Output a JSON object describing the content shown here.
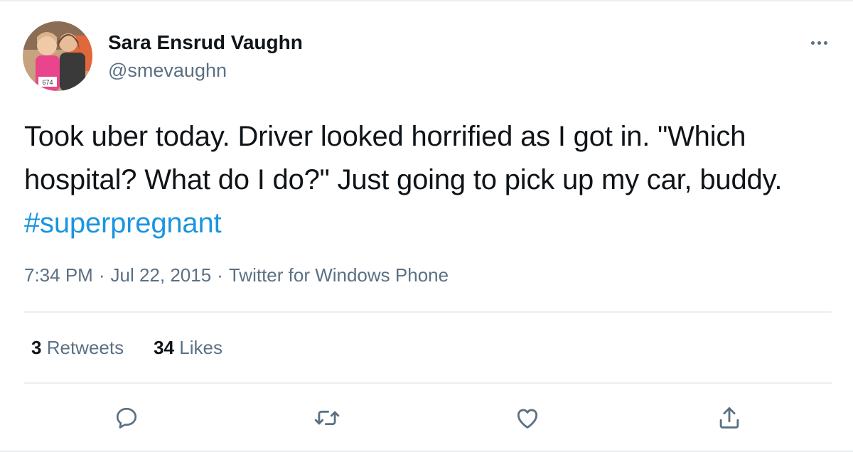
{
  "user": {
    "display_name": "Sara Ensrud Vaughn",
    "handle": "@smevaughn"
  },
  "tweet": {
    "text": "Took uber today. Driver looked horrified as I got in. \"Which hospital? What do I do?\" Just going to pick up my car, buddy. ",
    "hashtag": "#superpregnant"
  },
  "meta": {
    "time": "7:34 PM",
    "separator": "·",
    "date": "Jul 22, 2015",
    "source": "Twitter for Windows Phone"
  },
  "stats": {
    "retweets_count": "3",
    "retweets_label": "Retweets",
    "likes_count": "34",
    "likes_label": "Likes"
  },
  "actions": [
    "reply-icon",
    "retweet-icon",
    "like-icon",
    "share-icon"
  ],
  "colors": {
    "text": "#0f1419",
    "secondary": "#5b7083",
    "link": "#1b95e0",
    "divider": "#ebeef0"
  }
}
